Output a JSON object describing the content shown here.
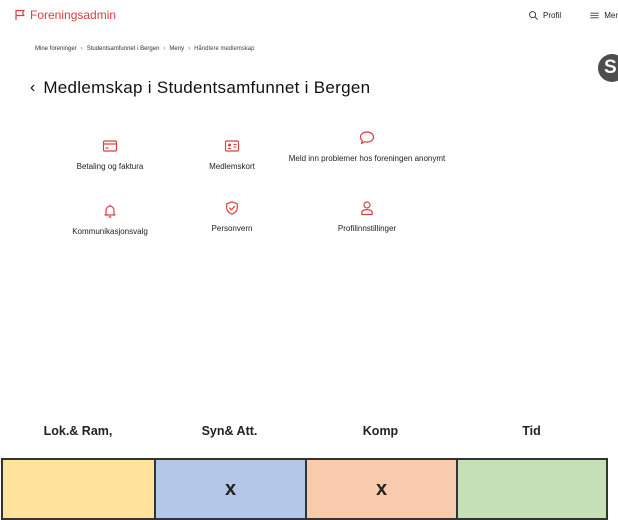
{
  "header": {
    "brand": "Foreningsadmin",
    "profile_label": "Profil",
    "menu_label": "Mer"
  },
  "breadcrumb": [
    "Mine foreninger",
    "Studentsamfunnet i Bergen",
    "Meny",
    "Håndtere medlemskap"
  ],
  "avatar_letter": "S",
  "page": {
    "title": "Medlemskap i Studentsamfunnet i Bergen"
  },
  "options": [
    {
      "label": "Betaling og faktura",
      "icon": "credit-card-icon"
    },
    {
      "label": "Medlemskort",
      "icon": "id-card-icon"
    },
    {
      "label": "Meld inn problemer hos foreningen anonymt",
      "icon": "chat-bubble-icon"
    },
    {
      "label": "Kommunikasjonsvalg",
      "icon": "bell-icon"
    },
    {
      "label": "Personvern",
      "icon": "shield-check-icon"
    },
    {
      "label": "Profilinnstillinger",
      "icon": "user-icon"
    }
  ],
  "annotation": {
    "headers": [
      "Lok.& Ram,",
      "Syn& Att.",
      "Komp",
      "Tid"
    ],
    "cells": [
      "",
      "x",
      "x",
      ""
    ],
    "colors": [
      "#fde49a",
      "#b4c7e7",
      "#f8cbad",
      "#c5e0b4"
    ]
  },
  "colors": {
    "accent": "#d8413f"
  }
}
